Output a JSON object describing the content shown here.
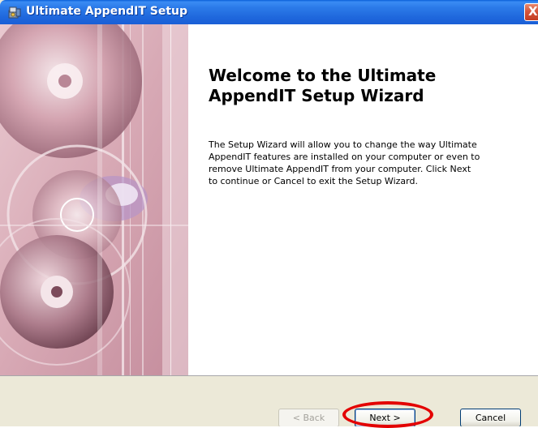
{
  "window": {
    "title": "Ultimate AppendIT Setup",
    "icons": {
      "app": "setup-package-icon",
      "close": "close-icon"
    },
    "close_glyph": "X",
    "colors": {
      "titlebar": "#2c7be9",
      "close": "#d5553b",
      "face": "#ece9d8"
    }
  },
  "welcome": {
    "title_line1": "Welcome to the Ultimate",
    "title_line2": "AppendIT Setup Wizard",
    "body_lines": [
      "The Setup Wizard will allow you to change the way Ultimate",
      "AppendIT features are installed on your computer or even to",
      "remove Ultimate AppendIT from your computer.  Click Next",
      "to continue or Cancel to exit the Setup Wizard."
    ]
  },
  "buttons": {
    "back": "< Back",
    "next": "Next >",
    "cancel": "Cancel"
  },
  "annotation": {
    "highlight_color": "#e30000",
    "highlight_target": "next-button"
  }
}
